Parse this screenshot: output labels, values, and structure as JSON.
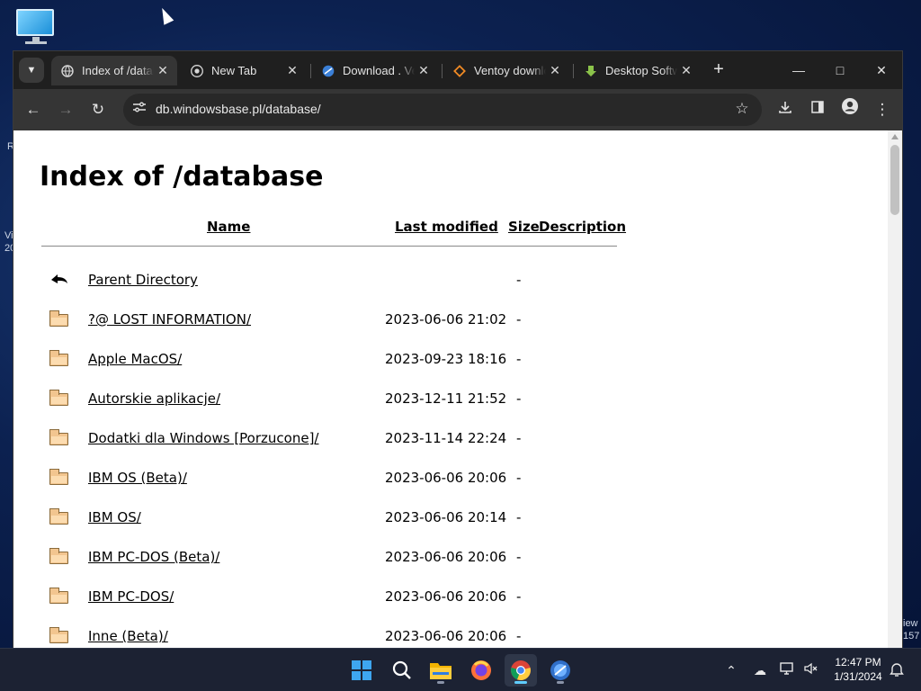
{
  "desktop": {
    "edge_left": [
      "R",
      "Vi",
      "20"
    ],
    "edge_right": [
      "iew",
      "157"
    ]
  },
  "browser": {
    "tabs": [
      {
        "title": "Index of /database",
        "icon": "globe-icon",
        "active": true
      },
      {
        "title": "New Tab",
        "icon": "chrome-icon",
        "active": false
      },
      {
        "title": "Download . Ventoy",
        "icon": "blue-orb-icon",
        "active": false
      },
      {
        "title": "Ventoy download",
        "icon": "ventoy-icon",
        "active": false
      },
      {
        "title": "Desktop Software",
        "icon": "download-arrow-icon",
        "active": false
      }
    ],
    "url": "db.windowsbase.pl/database/"
  },
  "page": {
    "title": "Index of /database",
    "columns": {
      "name": "Name",
      "last_modified": "Last modified",
      "size": "Size",
      "description": "Description"
    },
    "rows": [
      {
        "icon": "back-icon",
        "name": "Parent Directory",
        "date": "",
        "size": "-"
      },
      {
        "icon": "folder-icon",
        "name": "?@ LOST INFORMATION/",
        "date": "2023-06-06 21:02",
        "size": "-"
      },
      {
        "icon": "folder-icon",
        "name": "Apple MacOS/",
        "date": "2023-09-23 18:16",
        "size": "-"
      },
      {
        "icon": "folder-icon",
        "name": "Autorskie aplikacje/",
        "date": "2023-12-11 21:52",
        "size": "-"
      },
      {
        "icon": "folder-icon",
        "name": "Dodatki dla Windows [Porzucone]/",
        "date": "2023-11-14 22:24",
        "size": "-"
      },
      {
        "icon": "folder-icon",
        "name": "IBM OS (Beta)/",
        "date": "2023-06-06 20:06",
        "size": "-"
      },
      {
        "icon": "folder-icon",
        "name": "IBM OS/",
        "date": "2023-06-06 20:14",
        "size": "-"
      },
      {
        "icon": "folder-icon",
        "name": "IBM PC-DOS (Beta)/",
        "date": "2023-06-06 20:06",
        "size": "-"
      },
      {
        "icon": "folder-icon",
        "name": "IBM PC-DOS/",
        "date": "2023-06-06 20:06",
        "size": "-"
      },
      {
        "icon": "folder-icon",
        "name": "Inne (Beta)/",
        "date": "2023-06-06 20:06",
        "size": "-"
      }
    ]
  },
  "taskbar": {
    "apps": [
      {
        "name": "start-button",
        "active": false
      },
      {
        "name": "search-button",
        "active": false
      },
      {
        "name": "file-explorer-button",
        "active": false
      },
      {
        "name": "firefox-button",
        "active": false
      },
      {
        "name": "chrome-button",
        "active": true
      },
      {
        "name": "blue-app-button",
        "active": false
      }
    ],
    "time": "12:47 PM",
    "date": "1/31/2024"
  }
}
